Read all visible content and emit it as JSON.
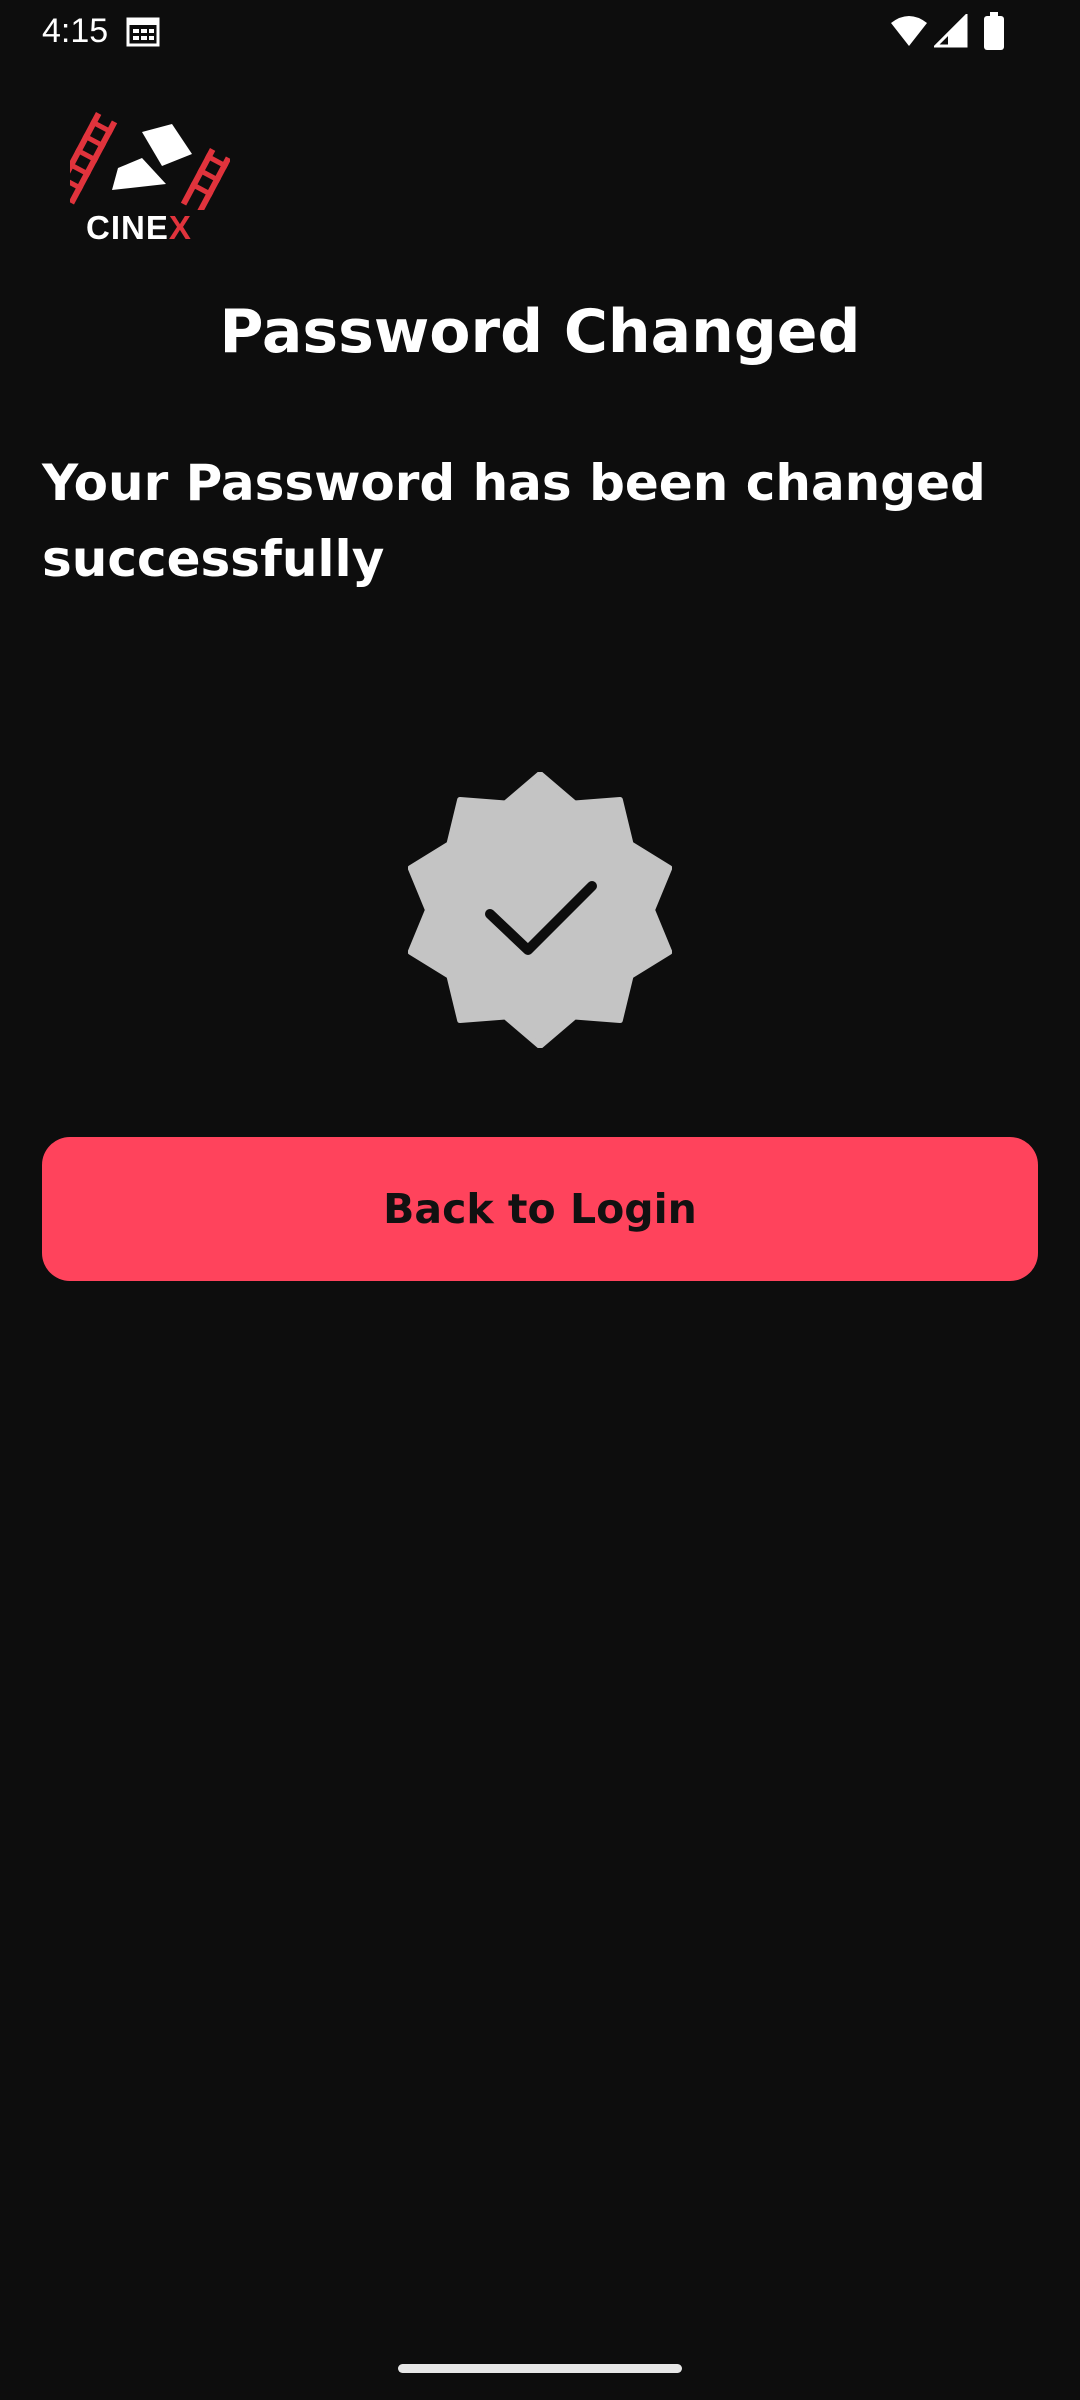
{
  "status_bar": {
    "time": "4:15",
    "icons": [
      "calendar-icon",
      "wifi-icon",
      "signal-icon",
      "battery-icon"
    ]
  },
  "logo": {
    "brand_prefix": "CINE",
    "brand_suffix": "X",
    "accent_color": "#e0333c"
  },
  "page": {
    "title": "Password Changed",
    "message": "Your Password has been changed successfully"
  },
  "badge": {
    "icon": "check-badge-icon",
    "fill_color": "#c4c4c4",
    "check_color": "#0d0d0d"
  },
  "actions": {
    "back_to_login_label": "Back to Login",
    "button_color": "#ff435c"
  },
  "theme": {
    "background": "#0d0d0d",
    "text": "#ffffff"
  }
}
